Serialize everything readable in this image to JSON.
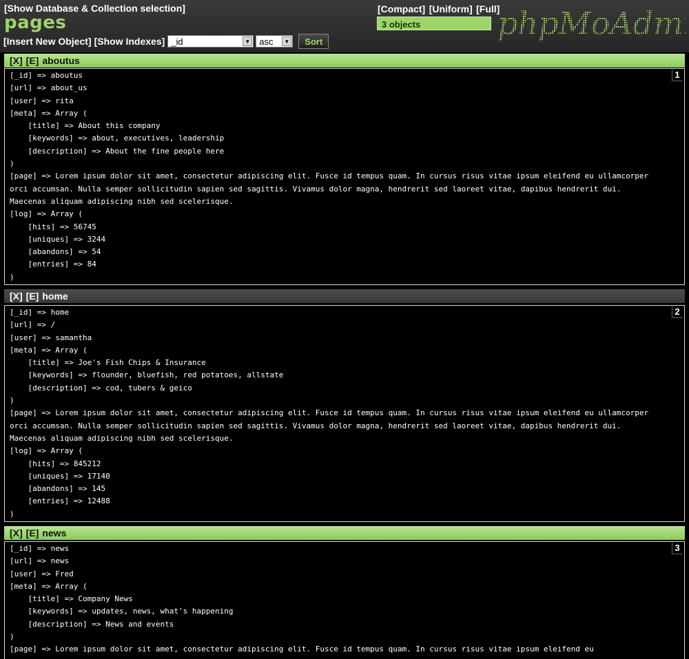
{
  "header": {
    "show_db_link": "[Show Database & Collection selection]",
    "collection": "pages",
    "insert_link": "[Insert New Object]",
    "indexes_link": "[Show Indexes]",
    "sort_field": "_id",
    "sort_order": "asc",
    "sort_button": "Sort",
    "view_compact": "[Compact]",
    "view_uniform": "[Uniform]",
    "view_full": "[Full]",
    "count": "3 objects",
    "logo": "phpMoAdmin"
  },
  "colors": {
    "accent": "#9ed56a",
    "background": "#000000",
    "header": "#333333"
  },
  "objects": [
    {
      "delete": "[X]",
      "edit": "[E]",
      "name": "aboutus",
      "num": "1",
      "lines": [
        "[_id] => aboutus",
        "[url] => about_us",
        "[user] => rita",
        "[meta] => Array (",
        "    [title] => About this company",
        "    [keywords] => about, executives, leadership",
        "    [description] => About the fine people here",
        ")"
      ],
      "page": "[page] => Lorem ipsum dolor sit amet, consectetur adipiscing elit. Fusce id tempus quam. In cursus risus vitae ipsum eleifend eu ullamcorper orci accumsan. Nulla semper sollicitudin sapien sed sagittis. Vivamus dolor magna, hendrerit sed laoreet vitae, dapibus hendrerit dui. Maecenas aliquam adipiscing nibh sed scelerisque.",
      "log": [
        "[log] => Array (",
        "    [hits] => 56745",
        "    [uniques] => 3244",
        "    [abandons] => 54",
        "    [entries] => 84",
        ")"
      ]
    },
    {
      "delete": "[X]",
      "edit": "[E]",
      "name": "home",
      "num": "2",
      "lines": [
        "[_id] => home",
        "[url] => /",
        "[user] => samantha",
        "[meta] => Array (",
        "    [title] => Joe's Fish Chips & Insurance",
        "    [keywords] => flounder, bluefish, red potatoes, allstate",
        "    [description] => cod, tubers & geico",
        ")"
      ],
      "page": "[page] => Lorem ipsum dolor sit amet, consectetur adipiscing elit. Fusce id tempus quam. In cursus risus vitae ipsum eleifend eu ullamcorper orci accumsan. Nulla semper sollicitudin sapien sed sagittis. Vivamus dolor magna, hendrerit sed laoreet vitae, dapibus hendrerit dui. Maecenas aliquam adipiscing nibh sed scelerisque.",
      "log": [
        "[log] => Array (",
        "    [hits] => 845212",
        "    [uniques] => 17140",
        "    [abandons] => 145",
        "    [entries] => 12488",
        ")"
      ]
    },
    {
      "delete": "[X]",
      "edit": "[E]",
      "name": "news",
      "num": "3",
      "lines": [
        "[_id] => news",
        "[url] => news",
        "[user] => Fred",
        "[meta] => Array (",
        "    [title] => Company News",
        "    [keywords] => updates, news, what's happening",
        "    [description] => News and events",
        ")"
      ],
      "page": "[page] => Lorem ipsum dolor sit amet, consectetur adipiscing elit. Fusce id tempus quam. In cursus risus vitae ipsum eleifend eu",
      "log": []
    }
  ]
}
